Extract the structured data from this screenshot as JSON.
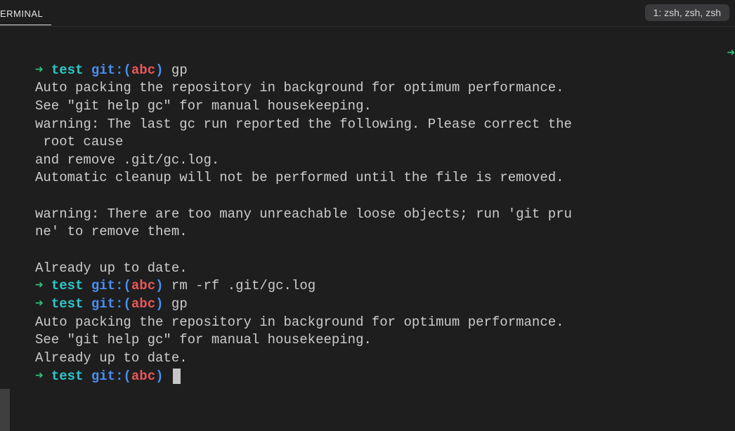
{
  "tab": {
    "label": "ERMINAL"
  },
  "session": {
    "label": "1: zsh, zsh, zsh"
  },
  "prompt": {
    "arrow": "➜",
    "dir": "test",
    "git_label": "git:",
    "branch": "abc",
    "paren_open": "(",
    "paren_close": ")"
  },
  "blocks": [
    {
      "cmd": "gp",
      "output": "Auto packing the repository in background for optimum performance.\nSee \"git help gc\" for manual housekeeping.\nwarning: The last gc run reported the following. Please correct the\n root cause\nand remove .git/gc.log.\nAutomatic cleanup will not be performed until the file is removed.\n\nwarning: There are too many unreachable loose objects; run 'git pru\nne' to remove them.\n\nAlready up to date."
    },
    {
      "cmd": "rm -rf .git/gc.log",
      "output": ""
    },
    {
      "cmd": "gp",
      "output": "Auto packing the repository in background for optimum performance.\nSee \"git help gc\" for manual housekeeping.\nAlready up to date."
    }
  ],
  "right_gutter": "➜"
}
